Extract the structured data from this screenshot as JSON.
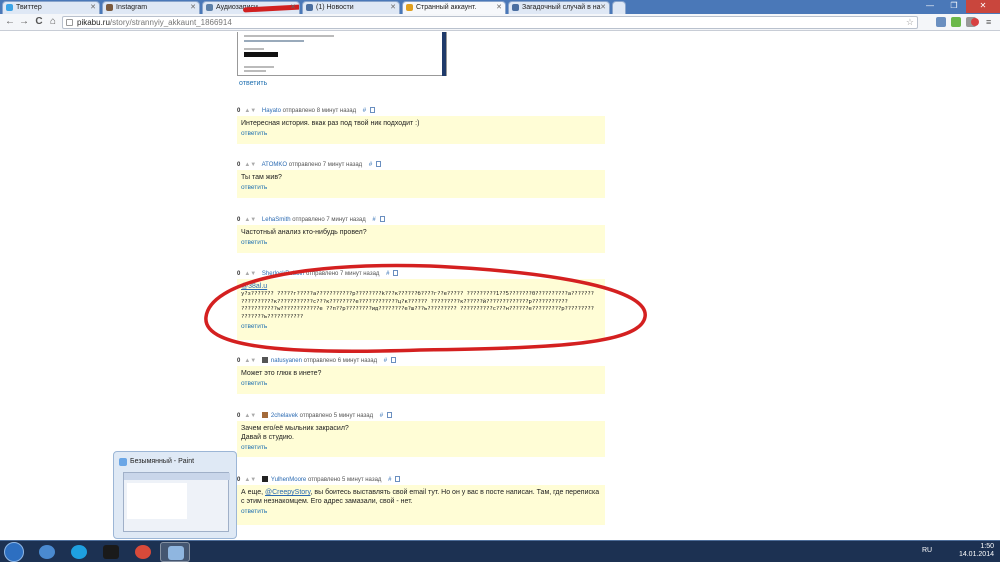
{
  "tabs": [
    {
      "label": "Твиттер",
      "color": "#3aa3e6"
    },
    {
      "label": "Instagram",
      "color": "#7b5a3e"
    },
    {
      "label": "Аудиозаписи",
      "color": "#5b7fa8"
    },
    {
      "label": "(1) Новости",
      "color": "#4a6ea0"
    },
    {
      "label": "Странный аккаунт.",
      "color": "#e0a020"
    },
    {
      "label": "Загадочный случай в на",
      "color": "#4a6ea0"
    }
  ],
  "window_buttons": {
    "minimize": "—",
    "maximize": "❐",
    "close": "✕"
  },
  "toolbar": {
    "back": "←",
    "forward": "→",
    "reload": "C",
    "home": "⌂",
    "url_host": "pikabu.ru",
    "url_path": "/story/strannyiy_akkaunt_1866914"
  },
  "preview_reply": "ответить",
  "comments": [
    {
      "score": "0",
      "user": "Hayato",
      "sent": "отправлено",
      "time": "8 минут назад",
      "text": "Интересная история. вкак раз под твой ник подходит :)",
      "reply": "ответить"
    },
    {
      "score": "0",
      "user": "ATOMKO",
      "sent": "отправлено",
      "time": "7 минут назад",
      "text": "Ты там жив?",
      "reply": "ответить"
    },
    {
      "score": "0",
      "user": "LehaSmith",
      "sent": "отправлено",
      "time": "7 минут назад",
      "text": "Частотный анализ кто-нибудь провел?",
      "reply": "ответить"
    },
    {
      "score": "0",
      "user": "SherlockRobbin",
      "sent": "отправлено",
      "time": "7 минут назад",
      "mention": "@38al.u",
      "text": "у?з??????? ?????г?????а???????????р????????k???к??????б????г??е????? ?????????1??5???????0??????????а??????? ??????????к???????????с???к????????е????????????ц?к?????? ?????????к??????й?????????????р??????????? ???????????w????????????е ??п??р????????ид????????е?ш???ь????????? ??????????с???н??????е?????????р????????? ???????ь???????????",
      "reply": "ответить"
    },
    {
      "score": "0",
      "user": "natusyanen",
      "sent": "отправлено",
      "time": "6 минут назад",
      "text": "Может это глюк в инете?",
      "reply": "ответить"
    },
    {
      "score": "0",
      "user": "2chelavek",
      "sent": "отправлено",
      "time": "5 минут назад",
      "text": "Зачем его/её мыльник закрасил?",
      "text2": "Давай в студию.",
      "reply": "ответить"
    },
    {
      "score": "0",
      "user": "YulhenMoore",
      "sent": "отправлено",
      "time": "5 минут назад",
      "text_pre": "А еще, ",
      "mention": "@CreepyStory",
      "text": ", вы боитесь выставлять свой email тут. Но он у вас в посте написан. Там, где переписка с этим незнакомцем. Его адрес замазали, свой - нет.",
      "reply": "ответить"
    }
  ],
  "annotation": {
    "color": "#d42020"
  },
  "paint_thumbnail": {
    "title": "Безымянный - Paint"
  },
  "taskbar": {
    "apps": [
      {
        "name": "internet-explorer",
        "color": "#4a8ad0"
      },
      {
        "name": "skype",
        "color": "#1ea0e0"
      },
      {
        "name": "steam",
        "color": "#1a1a1a"
      },
      {
        "name": "chrome",
        "color": "#d84a3a"
      },
      {
        "name": "paint",
        "color": "#8fb6e0"
      }
    ],
    "lang": "RU",
    "time": "1:50",
    "date": "14.01.2014"
  }
}
